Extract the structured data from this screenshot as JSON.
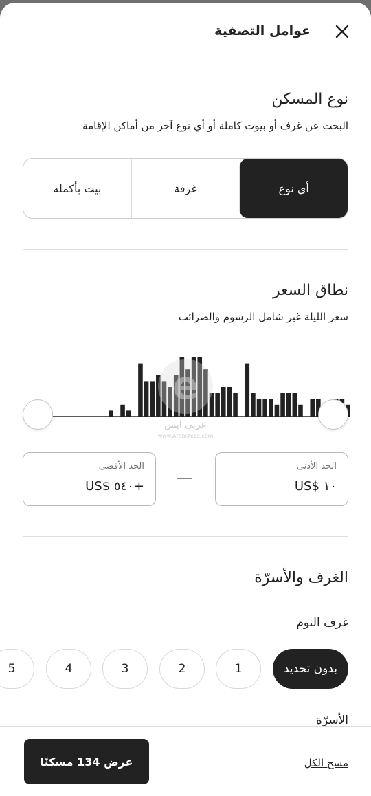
{
  "header": {
    "title": "عوامل التصفية",
    "close_icon": "close-icon"
  },
  "place_type": {
    "title": "نوع المسكن",
    "subtitle": "البحث عن غرف أو بيوت كاملة أو أي نوع آخر من أماكن الإقامة",
    "options": [
      "أي نوع",
      "غرفة",
      "بيت بأكمله"
    ],
    "selected": "أي نوع"
  },
  "price_range": {
    "title": "نطاق السعر",
    "subtitle": "سعر الليلة غير شامل الرسوم والضرائب",
    "histogram": [
      1,
      0,
      2,
      1,
      0,
      9,
      6,
      6,
      7,
      6,
      5,
      7,
      10,
      8,
      10,
      10,
      8,
      4,
      4,
      5,
      5,
      4,
      0,
      9,
      4,
      3,
      3,
      3,
      2,
      4,
      4,
      4,
      2,
      0,
      3,
      3,
      2,
      0,
      3,
      3,
      2
    ],
    "min_label": "الحد الأدنى",
    "min_value": "US$ ١٠",
    "max_label": "الحد الأقصى",
    "max_value": "US$ ٥٤٠+"
  },
  "rooms_beds": {
    "title": "الغرف والأسرّة",
    "bedrooms_label": "غرف النوم",
    "bedroom_options": [
      "بدون تحديد",
      "1",
      "2",
      "3",
      "4",
      "5"
    ],
    "selected": "بدون تحديد",
    "beds_label": "الأسرّة"
  },
  "watermark": {
    "text": "عربي ايس",
    "url": "www.ArabiAces.com"
  },
  "footer": {
    "clear_label": "مسح الكل",
    "show_label": "عرض 134 مسكنًا"
  },
  "colors": {
    "dark": "#222222",
    "border": "#dddddd",
    "muted": "#717171"
  }
}
